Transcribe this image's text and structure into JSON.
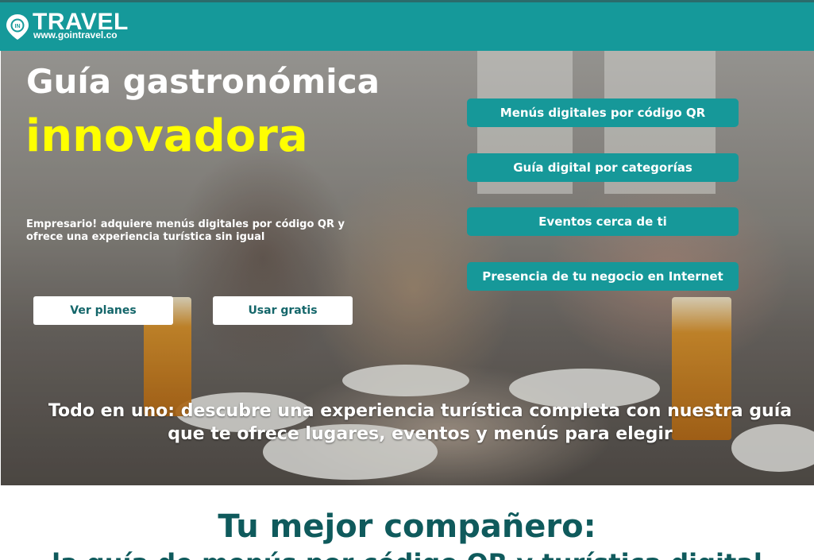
{
  "header": {
    "logo_word": "TRAVEL",
    "logo_badge": "IN",
    "logo_url": "www.gointravel.co"
  },
  "hero": {
    "title_line1": "Guía gastronómica",
    "title_line2": "innovadora",
    "description": "Empresario! adquiere menús digitales por código QR y ofrece una experiencia turística sin igual",
    "buttons": {
      "plans": "Ver planes",
      "free": "Usar gratis"
    },
    "features": [
      "Menús digitales por código QR",
      "Guía digital por categorías",
      "Eventos cerca de ti",
      "Presencia de tu negocio en Internet"
    ],
    "bottom_text": "Todo en uno: descubre una experiencia turística completa con nuestra guía que te ofrece lugares, eventos y menús para elegir"
  },
  "section": {
    "title": "Tu mejor compañero:",
    "subtitle": "la guía de menús por código QR y turística digital"
  },
  "colors": {
    "teal": "#15999a",
    "title_yellow": "#ffff00",
    "dark_teal": "#0f5a5c"
  }
}
